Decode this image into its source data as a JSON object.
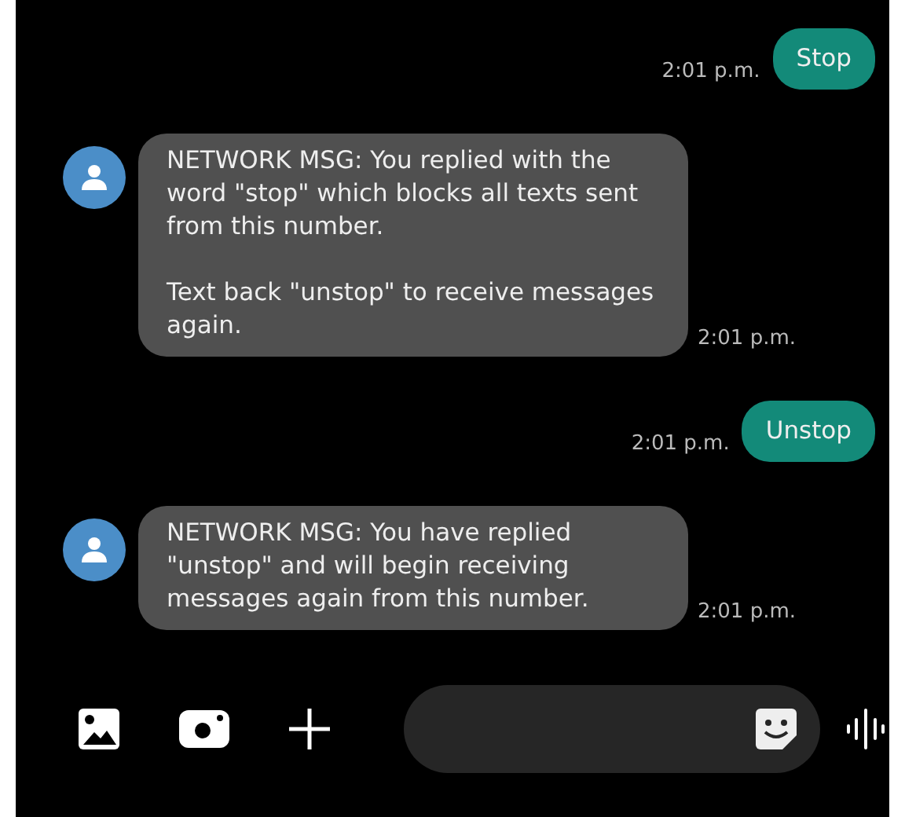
{
  "messages": [
    {
      "kind": "sent",
      "paragraphs": [
        "Stop"
      ],
      "time": "2:01 p.m."
    },
    {
      "kind": "received",
      "paragraphs": [
        "NETWORK MSG: You replied with the word \"stop\" which blocks all texts sent from this number.",
        "Text back \"unstop\" to receive messages again."
      ],
      "time": "2:01 p.m."
    },
    {
      "kind": "sent",
      "paragraphs": [
        "Unstop"
      ],
      "time": "2:01 p.m."
    },
    {
      "kind": "received",
      "paragraphs": [
        "NETWORK MSG: You have replied \"unstop\" and will begin receiving messages again from this number."
      ],
      "time": "2:01 p.m."
    }
  ]
}
